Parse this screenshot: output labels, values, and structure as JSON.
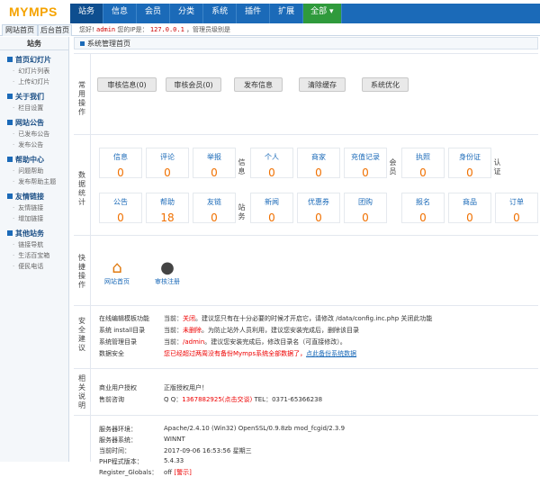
{
  "logo": "MYMPS",
  "nav": [
    "站务",
    "信息",
    "会员",
    "分类",
    "系统",
    "插件",
    "扩展",
    "全部 ▾"
  ],
  "tabs": [
    "网站首页",
    "后台首页"
  ],
  "welcome": {
    "pre": "您好!",
    "user": "admin",
    "mid": "您的IP是：",
    "ip": "127.0.0.1",
    "post": "，管理员级别是"
  },
  "side": {
    "head": "站务",
    "groups": [
      {
        "title": "首页幻灯片",
        "items": [
          "幻灯片列表",
          "上传幻灯片"
        ]
      },
      {
        "title": "关于我们",
        "items": [
          "栏目设置"
        ]
      },
      {
        "title": "网站公告",
        "items": [
          "已发布公告",
          "发布公告"
        ]
      },
      {
        "title": "帮助中心",
        "items": [
          "问题帮助",
          "发布帮助主题"
        ]
      },
      {
        "title": "友情链接",
        "items": [
          "友情链接",
          "增加链接"
        ]
      },
      {
        "title": "其他站务",
        "items": [
          "链接导航",
          "生活百宝箱",
          "便民电话"
        ]
      }
    ]
  },
  "main_title": "系统管理首页",
  "common": {
    "label": "常用操作",
    "buttons": [
      "审核信息(0)",
      "审核会员(0)",
      "发布信息",
      "清除缓存",
      "系统优化"
    ]
  },
  "stats": {
    "label": "数据统计",
    "row1": [
      {
        "l": "信息",
        "v": "0"
      },
      {
        "l": "评论",
        "v": "0"
      },
      {
        "l": "举报",
        "v": "0"
      }
    ],
    "row1b": [
      {
        "l": "个人",
        "v": "0"
      },
      {
        "l": "商家",
        "v": "0"
      },
      {
        "l": "充值记录",
        "v": "0"
      }
    ],
    "row1c": [
      {
        "l": "执照",
        "v": "0"
      },
      {
        "l": "身份证",
        "v": "0"
      }
    ],
    "row2": [
      {
        "l": "公告",
        "v": "0"
      },
      {
        "l": "帮助",
        "v": "18"
      },
      {
        "l": "友链",
        "v": "0"
      }
    ],
    "row2b": [
      {
        "l": "新闻",
        "v": "0"
      },
      {
        "l": "优惠券",
        "v": "0"
      },
      {
        "l": "团购",
        "v": "0"
      }
    ],
    "row2c": [
      {
        "l": "报名",
        "v": "0"
      },
      {
        "l": "商品",
        "v": "0"
      },
      {
        "l": "订单",
        "v": "0"
      }
    ],
    "v_info": "信息",
    "v_member": "会员",
    "v_auth": "认证",
    "v_site": "站务",
    "v_plugin": "插件"
  },
  "quick": {
    "label": "快捷操作",
    "items": [
      "网站首页",
      "审核注册"
    ]
  },
  "security": {
    "label": "安全建议",
    "rows": [
      {
        "k": "在线编辑模板功能",
        "a": "当前：",
        "b": "关闭",
        "c": "。建议您只有在十分必要的时候才开启它，请修改 /data/config.inc.php 关闭此功能"
      },
      {
        "k": "系统 install目录",
        "a": "当前：",
        "b": "未删除",
        "c": "。为防止站外人员利用，建议您安装完成后，删除该目录"
      },
      {
        "k": "系统管理目录",
        "a": "当前：",
        "b": "/admin",
        "c": "。建议您安装完成后，修改目录名（可直接修改）。"
      },
      {
        "k": "数据安全",
        "a": "",
        "b": "您已经超过两周没有备份Mymps系统全部数据了，",
        "c": "点此备份系统数据"
      }
    ]
  },
  "about": {
    "label": "相关说明",
    "rows": [
      {
        "k": "商业用户授权",
        "v": "正版授权用户！"
      },
      {
        "k": "售前咨询",
        "v": "Q Q：",
        "red": "1367882925(点击交谈)",
        "tel": " TEL：0371-65366238"
      }
    ]
  },
  "server": {
    "rows": [
      {
        "k": "服务器环境：",
        "v": "Apache/2.4.10 (Win32) OpenSSL/0.9.8zb mod_fcgid/2.3.9"
      },
      {
        "k": "服务器系统：",
        "v": "WINNT"
      },
      {
        "k": "当前时间：",
        "v": "2017-09-06 16:53:56 星期三"
      },
      {
        "k": "PHP程式版本：",
        "v": "5.4.33"
      },
      {
        "k": "Register_Globals：",
        "v": "off",
        "red": "[警示]"
      }
    ]
  }
}
